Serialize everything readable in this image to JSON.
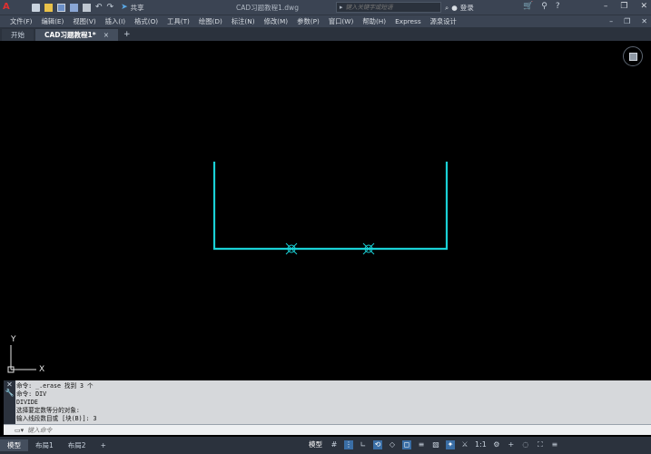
{
  "titlebar": {
    "doc_title": "CAD习题教程1.dwg",
    "share_label": "共享",
    "search_placeholder": "键入关键字或短语",
    "login_label": "登录"
  },
  "menu": [
    "文件(F)",
    "编辑(E)",
    "视图(V)",
    "插入(I)",
    "格式(O)",
    "工具(T)",
    "绘图(D)",
    "标注(N)",
    "修改(M)",
    "参数(P)",
    "窗口(W)",
    "帮助(H)",
    "Express",
    "源泉设计"
  ],
  "tabs": {
    "start": "开始",
    "active": "CAD习题教程1*",
    "close": "×",
    "add": "+"
  },
  "ucs": {
    "x_label": "X",
    "y_label": "Y"
  },
  "command_history": [
    "命令: _.erase 找到 3 个",
    "命令: DIV",
    "DIVIDE",
    "选择要定数等分的对象:",
    "输入线段数目或 [块(B)]: 3"
  ],
  "command_input": {
    "placeholder": "键入命令"
  },
  "layout_tabs": [
    "模型",
    "布局1",
    "布局2"
  ],
  "status": {
    "model_label": "模型",
    "scale_label": "1:1"
  },
  "colors": {
    "geometry": "#1ad1d6",
    "point_marker": "#1ad1d6",
    "ucs": "#e6e6e6"
  }
}
